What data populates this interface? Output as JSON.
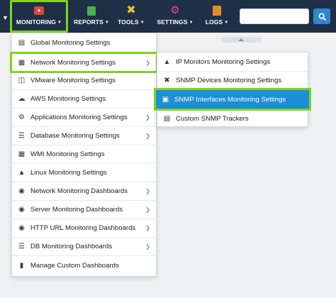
{
  "navbar": {
    "items": [
      {
        "label": "MONITORING",
        "icon": "monitor-icon",
        "active": true
      },
      {
        "label": "REPORTS",
        "icon": "reports-icon"
      },
      {
        "label": "TOOLS",
        "icon": "tools-icon"
      },
      {
        "label": "SETTINGS",
        "icon": "settings-icon"
      },
      {
        "label": "LOGS",
        "icon": "logs-icon"
      }
    ],
    "search": {
      "value": "",
      "placeholder": ""
    }
  },
  "monitoring_menu": {
    "items": [
      {
        "label": "Global Monitoring Settings",
        "icon": "document-icon",
        "has_submenu": false
      },
      {
        "label": "Network Monitoring Settings",
        "icon": "network-icon",
        "has_submenu": true
      },
      {
        "label": "VMware Monitoring Settings",
        "icon": "vmware-icon",
        "has_submenu": false
      },
      {
        "label": "AWS Monitoring Settings",
        "icon": "cloud-icon",
        "has_submenu": false
      },
      {
        "label": "Applications Monitoring Settings",
        "icon": "gear-icon",
        "has_submenu": true
      },
      {
        "label": "Database Monitoring Settings",
        "icon": "database-icon",
        "has_submenu": true
      },
      {
        "label": "WMI Monitoring Settings",
        "icon": "windows-icon",
        "has_submenu": false
      },
      {
        "label": "Linux Monitoring Settings",
        "icon": "linux-icon",
        "has_submenu": false
      },
      {
        "label": "Network Monitoring Dashboards",
        "icon": "wifi-icon",
        "has_submenu": true
      },
      {
        "label": "Server Monitoring Dashboards",
        "icon": "globe-icon",
        "has_submenu": true
      },
      {
        "label": "HTTP URL Monitoring Dashboards",
        "icon": "globe-icon",
        "has_submenu": true
      },
      {
        "label": "DB Monitoring Dashboards",
        "icon": "database-icon",
        "has_submenu": true
      },
      {
        "label": "Manage Custom Dashboards",
        "icon": "bars-icon",
        "has_submenu": false
      }
    ]
  },
  "network_submenu": {
    "items": [
      {
        "label": "IP Monitors Monitoring Settings",
        "icon": "ip-monitor-icon"
      },
      {
        "label": "SNMP Devices Monitoring Settings",
        "icon": "snmp-device-icon"
      },
      {
        "label": "SNMP Interfaces Monitoring Settings",
        "icon": "snmp-interface-icon",
        "selected": true
      },
      {
        "label": "Custom SNMP Trackers",
        "icon": "document-icon"
      }
    ]
  },
  "colors": {
    "navbar_bg": "#1f3046",
    "highlight_outline": "#7ed321",
    "selected_bg": "#1c8fd6"
  }
}
